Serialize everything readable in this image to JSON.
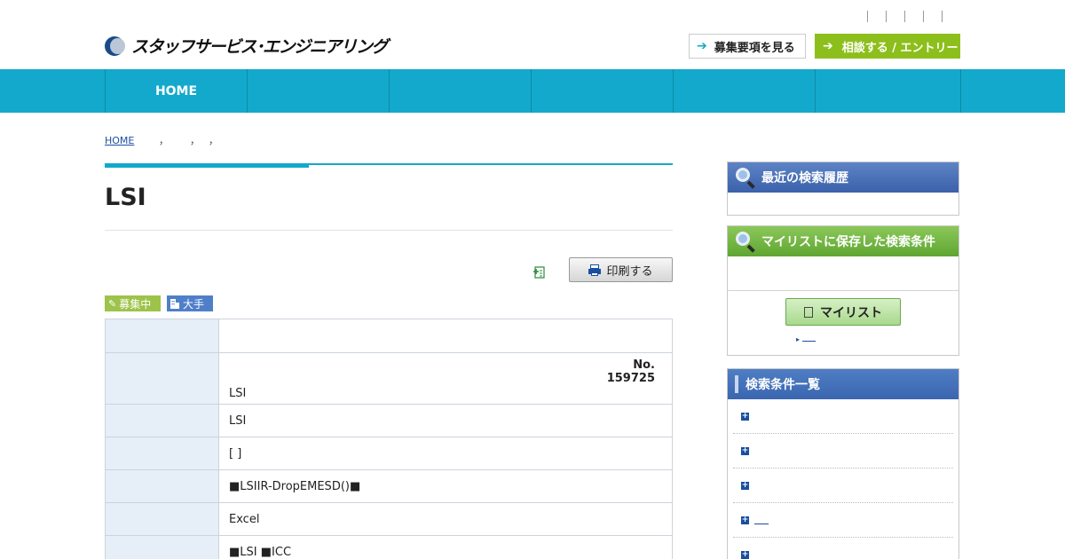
{
  "header": {
    "logo_text": "スタッフサービス･エンジニアリング",
    "requirements_button": "募集要項を見る",
    "entry_button": "相談する / エントリー",
    "arrow_glyph": "➔"
  },
  "nav": {
    "items": [
      {
        "label": "HOME"
      },
      {
        "label": ""
      },
      {
        "label": ""
      },
      {
        "label": ""
      },
      {
        "label": ""
      },
      {
        "label": ""
      }
    ]
  },
  "breadcrumb": {
    "home": "HOME",
    "sep": "，"
  },
  "main": {
    "title": "LSI",
    "print_button": "印刷する",
    "badges": {
      "recruiting": "募集中",
      "major": "大手"
    },
    "job_no_label": "No.",
    "job_no": "159725",
    "rows": [
      {
        "value": ""
      },
      {
        "value": "LSI"
      },
      {
        "value": "LSI"
      },
      {
        "value": "[  ]"
      },
      {
        "value": "■LSIIR-DropEMESD()■"
      },
      {
        "value": "Excel"
      },
      {
        "value": " ■LSI ■ICC"
      }
    ]
  },
  "sidebar": {
    "recent_history_title": "最近の検索履歴",
    "saved_conditions_title": "マイリストに保存した検索条件",
    "mylist_button": "マイリスト",
    "condition_list_title": "検索条件一覧",
    "plus_glyph": "+"
  },
  "colors": {
    "nav": "#13a9cc",
    "entry": "#8dbf1c",
    "recruit_badge": "#9dc34a",
    "major_badge": "#4f7fc9",
    "table_header": "#e6eef8"
  }
}
